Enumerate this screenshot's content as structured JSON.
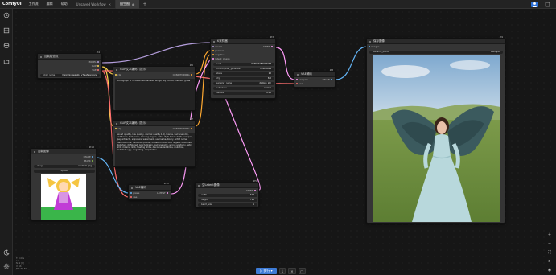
{
  "app": {
    "logo": "ComfyUI",
    "menu": [
      "工作流",
      "编辑",
      "帮助"
    ],
    "tabs": [
      {
        "label": "Unsaved Workflow",
        "close": "✕",
        "active": false
      },
      {
        "label": "图生图",
        "close": "●",
        "active": true
      }
    ],
    "add_tab": "+"
  },
  "sidebar": {
    "icons": [
      "history-icon",
      "node-library-icon",
      "model-library-icon",
      "workflows-icon",
      "theme-icon",
      "settings-icon"
    ]
  },
  "nodes": {
    "load_ckpt": {
      "title": "加载检查点",
      "id": "#4",
      "outputs": [
        "MODEL",
        "CLIP",
        "VAE"
      ],
      "ckpt_label": "ckpt_name",
      "ckpt_value": "majicmixRealistic_v7.safetensors"
    },
    "ksampler": {
      "title": "K采样器",
      "id": "#3",
      "inputs": [
        "model",
        "positive",
        "negative",
        "latent_image"
      ],
      "output": "LATENT",
      "widgets": [
        {
          "label": "seed",
          "value": "923837484923748"
        },
        {
          "label": "control_after_generate",
          "value": "randomize"
        },
        {
          "label": "steps",
          "value": "20"
        },
        {
          "label": "cfg",
          "value": "8.0"
        },
        {
          "label": "sampler_name",
          "value": "dpmpp_2m"
        },
        {
          "label": "scheduler",
          "value": "normal"
        },
        {
          "label": "denoise",
          "value": "0.80"
        }
      ]
    },
    "clip_pos": {
      "title": "CLIP文本编码（提示）",
      "id": "#6",
      "input": "clip",
      "output": "CONDITIONING",
      "text": "photograph of victorian woman with wings, sky clouds, meadow grass"
    },
    "clip_neg": {
      "title": "CLIP文本编码（提示）",
      "id": "#7",
      "input": "clip",
      "output": "CONDITIONING",
      "text": "(worst quality, low quality, normal quality:1.4), lowres, bad anatomy, bad hands, text, error, missing fingers, extra digit, fewer digits, cropped, jpeg artifacts, signature, watermark, username, blurry, artist name, (deformed iris, deformed pupils), mutated hands and fingers, deformed, distorted, disfigured, poorly drawn, bad anatomy, wrong anatomy, extra limb, missing limb, floating limbs, disconnected limbs, mutation, mutated, ugly, disgusting, amputation"
    },
    "vae_decode": {
      "title": "VAE解码",
      "id": "#8",
      "inputs": [
        "samples",
        "vae"
      ],
      "output": "IMAGE"
    },
    "save_image": {
      "title": "保存图像",
      "id": "#9",
      "input": "images",
      "prefix_label": "filename_prefix",
      "prefix_value": "ComfyUI"
    },
    "load_image": {
      "title": "加载图像",
      "id": "#10",
      "outputs": [
        "IMAGE",
        "MASK"
      ],
      "image_label": "image",
      "image_value": "example.png",
      "upload_label": "upload"
    },
    "vae_encode": {
      "title": "VAE编码",
      "id": "#12",
      "inputs": [
        "pixels",
        "vae"
      ],
      "output": "LATENT"
    },
    "empty_latent": {
      "title": "空Latent图像",
      "id": "#5",
      "output": "LATENT",
      "widgets": [
        {
          "label": "width",
          "value": "512"
        },
        {
          "label": "height",
          "value": "768"
        },
        {
          "label": "batch_size",
          "value": "1"
        }
      ]
    }
  },
  "bottom": {
    "run_label": "执行",
    "queue_count": "1",
    "cancel_icon": "✕",
    "stop_icon": "□"
  },
  "stats": [
    "T: 0.00s",
    "I: 0",
    "N: 9 [9]",
    "V: 16",
    "FPS:55.56"
  ],
  "colors": {
    "model": "#b39ddb",
    "clip": "#ffd54f",
    "vae": "#ff6e6e",
    "conditioning": "#ffa931",
    "latent": "#ff9cf9",
    "image": "#64b5f6",
    "accent": "#3d7bd6"
  }
}
